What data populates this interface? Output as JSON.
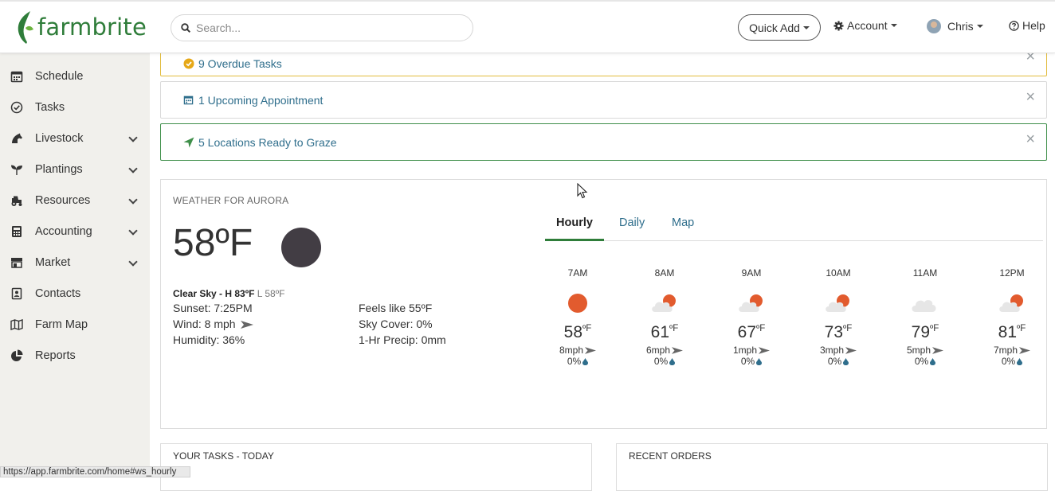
{
  "brand": {
    "name": "farmbrite",
    "color": "#2f7d3a"
  },
  "header": {
    "search_placeholder": "Search...",
    "quick_add": "Quick Add",
    "account": "Account",
    "user": "Chris",
    "help": "Help"
  },
  "sidebar": {
    "items": [
      {
        "label": "Schedule",
        "icon": "calendar-icon",
        "has_submenu": false
      },
      {
        "label": "Tasks",
        "icon": "check-circle-icon",
        "has_submenu": false
      },
      {
        "label": "Livestock",
        "icon": "horse-icon",
        "has_submenu": true
      },
      {
        "label": "Plantings",
        "icon": "seedling-icon",
        "has_submenu": true
      },
      {
        "label": "Resources",
        "icon": "tractor-icon",
        "has_submenu": true
      },
      {
        "label": "Accounting",
        "icon": "calculator-icon",
        "has_submenu": true
      },
      {
        "label": "Market",
        "icon": "store-icon",
        "has_submenu": true
      },
      {
        "label": "Contacts",
        "icon": "address-book-icon",
        "has_submenu": false
      },
      {
        "label": "Farm Map",
        "icon": "map-icon",
        "has_submenu": false
      },
      {
        "label": "Reports",
        "icon": "pie-chart-icon",
        "has_submenu": false
      }
    ]
  },
  "alerts": {
    "overdue": "9 Overdue Tasks",
    "appointment": "1 Upcoming Appointment",
    "graze": "5 Locations Ready to Graze",
    "close_glyph": "×"
  },
  "weather": {
    "title": "WEATHER FOR AURORA",
    "temp": "58",
    "unit": "ºF",
    "condition": "Clear Sky - H 83ºF",
    "low": "L 58ºF",
    "sunset": "Sunset: 7:25PM",
    "wind": "Wind: 8 mph",
    "humidity": "Humidity: 36%",
    "feels_like": "Feels like 55ºF",
    "sky_cover": "Sky Cover: 0%",
    "precip": "1-Hr Precip: 0mm",
    "tabs": [
      "Hourly",
      "Daily",
      "Map"
    ],
    "active_tab": "Hourly",
    "hourly": [
      {
        "time": "7AM",
        "temp": "58",
        "unit": "ºF",
        "wind": "8mph",
        "precip": "0%",
        "icon": "sun-icon"
      },
      {
        "time": "8AM",
        "temp": "61",
        "unit": "ºF",
        "wind": "6mph",
        "precip": "0%",
        "icon": "partly-cloudy-icon"
      },
      {
        "time": "9AM",
        "temp": "67",
        "unit": "ºF",
        "wind": "1mph",
        "precip": "0%",
        "icon": "partly-cloudy-icon"
      },
      {
        "time": "10AM",
        "temp": "73",
        "unit": "ºF",
        "wind": "3mph",
        "precip": "0%",
        "icon": "partly-cloudy-icon"
      },
      {
        "time": "11AM",
        "temp": "79",
        "unit": "ºF",
        "wind": "5mph",
        "precip": "0%",
        "icon": "cloud-icon"
      },
      {
        "time": "12PM",
        "temp": "81",
        "unit": "ºF",
        "wind": "7mph",
        "precip": "0%",
        "icon": "partly-cloudy-icon"
      }
    ]
  },
  "panels": {
    "tasks_title": "YOUR TASKS - TODAY",
    "orders_title": "RECENT ORDERS"
  },
  "status_url": "https://app.farmbrite.com/home#ws_hourly"
}
